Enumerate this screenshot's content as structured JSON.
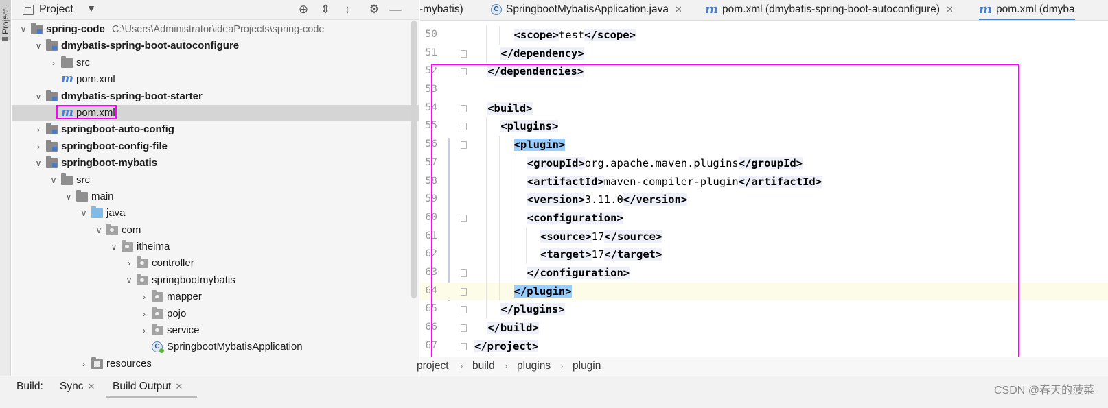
{
  "sidebar_strip": {
    "label": "Project"
  },
  "project_panel": {
    "title": "Project",
    "tree": [
      {
        "label": "spring-code",
        "path": "C:\\Users\\Administrator\\ideaProjects\\spring-code",
        "bold": true,
        "icon": "module-icon",
        "arrow": "expanded",
        "level": 0
      },
      {
        "label": "dmybatis-spring-boot-autoconfigure",
        "bold": true,
        "icon": "module-icon",
        "arrow": "expanded",
        "level": 1
      },
      {
        "label": "src",
        "icon": "folder-icon",
        "arrow": "collapsed",
        "level": 2
      },
      {
        "label": "pom.xml",
        "icon": "maven-icon",
        "arrow": "none",
        "level": 2
      },
      {
        "label": "dmybatis-spring-boot-starter",
        "bold": true,
        "icon": "module-icon",
        "arrow": "expanded",
        "level": 1
      },
      {
        "label": "pom.xml",
        "icon": "maven-icon",
        "arrow": "none",
        "level": 2,
        "selected": true
      },
      {
        "label": "springboot-auto-config",
        "bold": true,
        "icon": "module-icon",
        "arrow": "collapsed",
        "level": 1
      },
      {
        "label": "springboot-config-file",
        "bold": true,
        "icon": "module-icon",
        "arrow": "collapsed",
        "level": 1
      },
      {
        "label": "springboot-mybatis",
        "bold": true,
        "icon": "module-icon",
        "arrow": "expanded",
        "level": 1
      },
      {
        "label": "src",
        "icon": "folder-icon",
        "arrow": "expanded",
        "level": 2
      },
      {
        "label": "main",
        "icon": "folder-icon",
        "arrow": "expanded",
        "level": 3
      },
      {
        "label": "java",
        "icon": "source-folder-icon",
        "arrow": "expanded",
        "level": 4
      },
      {
        "label": "com",
        "icon": "package-icon",
        "arrow": "expanded",
        "level": 5
      },
      {
        "label": "itheima",
        "icon": "package-icon",
        "arrow": "expanded",
        "level": 6
      },
      {
        "label": "controller",
        "icon": "package-icon",
        "arrow": "collapsed",
        "level": 7
      },
      {
        "label": "springbootmybatis",
        "icon": "package-icon",
        "arrow": "expanded",
        "level": 7
      },
      {
        "label": "mapper",
        "icon": "package-icon",
        "arrow": "collapsed",
        "level": 8
      },
      {
        "label": "pojo",
        "icon": "package-icon",
        "arrow": "collapsed",
        "level": 8
      },
      {
        "label": "service",
        "icon": "package-icon",
        "arrow": "collapsed",
        "level": 8
      },
      {
        "label": "SpringbootMybatisApplication",
        "icon": "spring-class-icon",
        "arrow": "none",
        "level": 8
      },
      {
        "label": "resources",
        "icon": "resources-folder-icon",
        "arrow": "collapsed",
        "level": 4
      }
    ]
  },
  "editor_tabs": [
    {
      "label": "ot-mybatis)",
      "icon": "none",
      "close": false
    },
    {
      "label": "SpringbootMybatisApplication.java",
      "icon": "spring-class-icon",
      "close": true
    },
    {
      "label": "pom.xml (dmybatis-spring-boot-autoconfigure)",
      "icon": "maven-icon",
      "close": true
    },
    {
      "label": "pom.xml (dmyba",
      "icon": "maven-icon",
      "close": false,
      "active": true
    }
  ],
  "code_lines": [
    {
      "num": "50",
      "indent": 2,
      "parts": [
        [
          "tag",
          "<scope>"
        ],
        [
          "text",
          "test"
        ],
        [
          "tag",
          "</scope>"
        ]
      ]
    },
    {
      "num": "51",
      "indent": 1,
      "parts": [
        [
          "tag",
          "</dependency>"
        ]
      ],
      "fold": true
    },
    {
      "num": "52",
      "indent": 0,
      "parts": [
        [
          "tag",
          "</dependencies>"
        ]
      ],
      "fold": true
    },
    {
      "num": "53",
      "indent": 0,
      "parts": []
    },
    {
      "num": "54",
      "indent": 0,
      "parts": [
        [
          "tag",
          "<build>"
        ]
      ],
      "fold": true
    },
    {
      "num": "55",
      "indent": 1,
      "parts": [
        [
          "tag",
          "<plugins>"
        ]
      ],
      "fold": true
    },
    {
      "num": "56",
      "indent": 2,
      "parts": [
        [
          "tagm",
          "<plugin>"
        ]
      ],
      "fold": true
    },
    {
      "num": "57",
      "indent": 3,
      "parts": [
        [
          "tag",
          "<groupId>"
        ],
        [
          "text",
          "org.apache.maven.plugins"
        ],
        [
          "tag",
          "</groupId>"
        ]
      ]
    },
    {
      "num": "58",
      "indent": 3,
      "parts": [
        [
          "tag",
          "<artifactId>"
        ],
        [
          "text",
          "maven-compiler-plugin"
        ],
        [
          "tag",
          "</artifactId>"
        ]
      ]
    },
    {
      "num": "59",
      "indent": 3,
      "parts": [
        [
          "tag",
          "<version>"
        ],
        [
          "text",
          "3.11.0"
        ],
        [
          "tag",
          "</version>"
        ]
      ]
    },
    {
      "num": "60",
      "indent": 3,
      "parts": [
        [
          "tag",
          "<configuration>"
        ]
      ],
      "fold": true
    },
    {
      "num": "61",
      "indent": 4,
      "parts": [
        [
          "tag",
          "<source>"
        ],
        [
          "text",
          "17"
        ],
        [
          "tag",
          "</source>"
        ]
      ]
    },
    {
      "num": "62",
      "indent": 4,
      "parts": [
        [
          "tag",
          "<target>"
        ],
        [
          "text",
          "17"
        ],
        [
          "tag",
          "</target>"
        ]
      ]
    },
    {
      "num": "63",
      "indent": 3,
      "parts": [
        [
          "tag",
          "</configuration>"
        ]
      ],
      "fold": true
    },
    {
      "num": "64",
      "indent": 2,
      "parts": [
        [
          "tagm",
          "</plugin>"
        ]
      ],
      "fold": true,
      "current": true
    },
    {
      "num": "65",
      "indent": 1,
      "parts": [
        [
          "tag",
          "</plugins>"
        ]
      ],
      "fold": true
    },
    {
      "num": "66",
      "indent": 0,
      "parts": [
        [
          "tag",
          "</build>"
        ]
      ],
      "fold": true
    },
    {
      "num": "67",
      "indent": -1,
      "parts": [
        [
          "tag",
          "</project>"
        ]
      ],
      "fold": true
    }
  ],
  "breadcrumb": [
    "project",
    "build",
    "plugins",
    "plugin"
  ],
  "bottom_tabs": [
    {
      "label": "Build:",
      "close": false
    },
    {
      "label": "Sync",
      "close": true
    },
    {
      "label": "Build Output",
      "close": true,
      "active": true
    }
  ],
  "watermark": "CSDN @春天的菠菜",
  "colors": {
    "highlight": "#ff00ff",
    "accent": "#4083c9",
    "tag_match": "#99ccff"
  }
}
